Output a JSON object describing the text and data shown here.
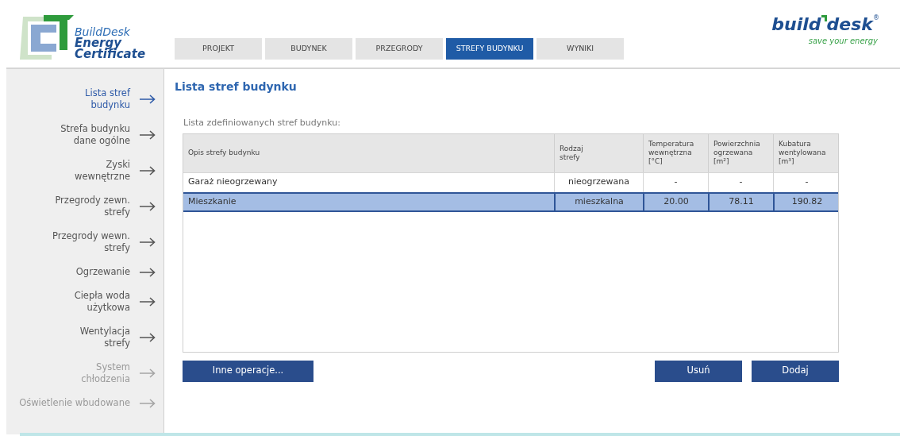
{
  "logo": {
    "line_1": "BuildDesk",
    "line_2": "Energy",
    "line_3": "Certificate"
  },
  "tabs": [
    {
      "label": "PROJEKT",
      "selected": false
    },
    {
      "label": "BUDYNEK",
      "selected": false
    },
    {
      "label": "PRZEGRODY",
      "selected": false
    },
    {
      "label": "STREFY BUDYNKU",
      "selected": true
    },
    {
      "label": "WYNIKI",
      "selected": false
    }
  ],
  "brand": {
    "word_1": "build",
    "word_2": "desk",
    "registered": "®",
    "tagline": "save your energy"
  },
  "sidebar": {
    "items": [
      {
        "label": "Lista stref\nbudynku",
        "selected": true,
        "disabled": false
      },
      {
        "label": "Strefa budynku\ndane ogólne",
        "selected": false,
        "disabled": false
      },
      {
        "label": "Zyski\nwewnętrzne",
        "selected": false,
        "disabled": false
      },
      {
        "label": "Przegrody zewn.\nstrefy",
        "selected": false,
        "disabled": false
      },
      {
        "label": "Przegrody wewn.\nstrefy",
        "selected": false,
        "disabled": false
      },
      {
        "label": "Ogrzewanie",
        "selected": false,
        "disabled": false
      },
      {
        "label": "Ciepła woda\nużytkowa",
        "selected": false,
        "disabled": false
      },
      {
        "label": "Wentylacja\nstrefy",
        "selected": false,
        "disabled": false
      },
      {
        "label": "System\nchłodzenia",
        "selected": false,
        "disabled": true
      },
      {
        "label": "Oświetlenie wbudowane",
        "selected": false,
        "disabled": true
      }
    ]
  },
  "page_title": "Lista stref budynku",
  "table": {
    "caption": "Lista zdefiniowanych stref budynku:",
    "columns": [
      "Opis strefy budynku",
      "Rodzaj\nstrefy",
      "Temperatura\nwewnętrzna\n[°C]",
      "Powierzchnia\nogrzewana\n[m²]",
      "Kubatura\nwentylowana\n[m³]"
    ],
    "rows": [
      {
        "cells": [
          "Garaż nieogrzewany",
          "nieogrzewana",
          "-",
          "-",
          "-"
        ],
        "selected": false
      },
      {
        "cells": [
          "Mieszkanie",
          "mieszkalna",
          "20.00",
          "78.11",
          "190.82"
        ],
        "selected": true
      }
    ]
  },
  "buttons": {
    "left": [
      "Inne operacje..."
    ],
    "right": [
      "Usuń",
      "Dodaj"
    ]
  }
}
